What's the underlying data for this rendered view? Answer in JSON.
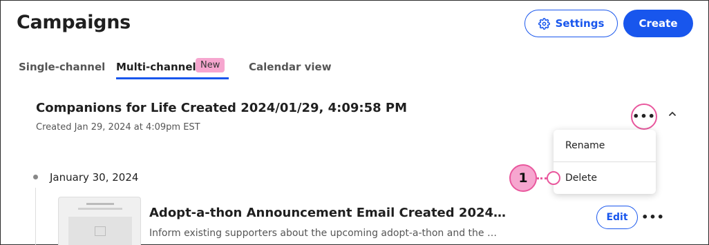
{
  "header": {
    "title": "Campaigns",
    "settings_label": "Settings",
    "create_label": "Create"
  },
  "tabs": [
    {
      "label": "Single-channel",
      "active": false
    },
    {
      "label": "Multi-channel",
      "active": true,
      "badge": "New"
    },
    {
      "label": "Calendar view",
      "active": false
    }
  ],
  "campaign": {
    "title": "Companions for Life Created 2024/01/29, 4:09:58 PM",
    "meta": "Created Jan 29, 2024 at 4:09pm EST"
  },
  "menu": {
    "items": [
      "Rename",
      "Delete"
    ]
  },
  "callout": {
    "number": "1"
  },
  "timeline": {
    "date": "January 30, 2024"
  },
  "email": {
    "title": "Adopt-a-thon Announcement Email Created 2024…",
    "description": "Inform existing supporters about the upcoming adopt-a-thon and the …",
    "edit_label": "Edit"
  },
  "colors": {
    "primary": "#1856ed",
    "highlight": "#e9579d",
    "badge": "#f6a6cf"
  },
  "icons": {
    "settings": "gear-icon",
    "more": "more-horizontal-icon",
    "collapse": "chevron-up-icon"
  }
}
